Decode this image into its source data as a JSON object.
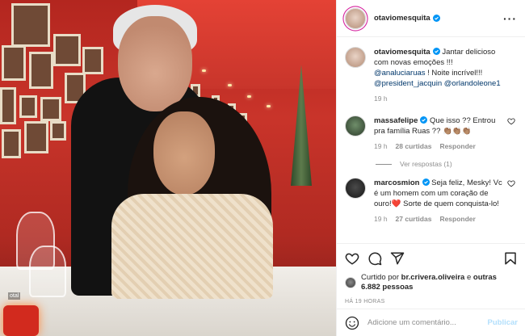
{
  "post": {
    "author": "otaviomesquita",
    "author_verified": true,
    "more_icon": "more-horizontal-icon"
  },
  "photo": {
    "table_label": "otal"
  },
  "caption": {
    "username": "otaviomesquita",
    "text_before": " Jantar delicioso com novas emoções !!! ",
    "mention_1": "@analuciaruas",
    "text_middle": " ! Noite incrível!!! ",
    "mention_2": "@president_jacquin",
    "mention_3": "@orlandoleone1",
    "time": "19 h"
  },
  "comments": [
    {
      "username": "massafelipe",
      "verified": true,
      "text": " Que isso ?? Entrou pra família Ruas ?? 👏🏽👏🏽👏🏽",
      "time": "19 h",
      "likes": "28 curtidas",
      "reply": "Responder",
      "view_replies": "Ver respostas (1)"
    },
    {
      "username": "marcosmion",
      "verified": true,
      "text": " Seja feliz, Mesky! Vc é um homem com um coração de ouro!❤️ Sorte de quem conquista-lo!",
      "time": "19 h",
      "likes": "27 curtidas",
      "reply": "Responder"
    }
  ],
  "actions": {
    "like_icon": "heart-icon",
    "comment_icon": "comment-icon",
    "share_icon": "share-icon",
    "save_icon": "bookmark-icon"
  },
  "likes": {
    "prefix": "Curtido por ",
    "user": "br.crivera.oliveira",
    "middle": " e ",
    "others": "outras 6.882 pessoas"
  },
  "timestamp": "HÁ 19 HORAS",
  "add_comment": {
    "emoji_icon": "emoji-icon",
    "placeholder": "Adicione um comentário...",
    "publish": "Publicar"
  },
  "colors": {
    "verified_blue": "#0095f6",
    "link": "#00376b",
    "muted": "#8e8e8e",
    "publish_disabled": "#b2dffc"
  }
}
